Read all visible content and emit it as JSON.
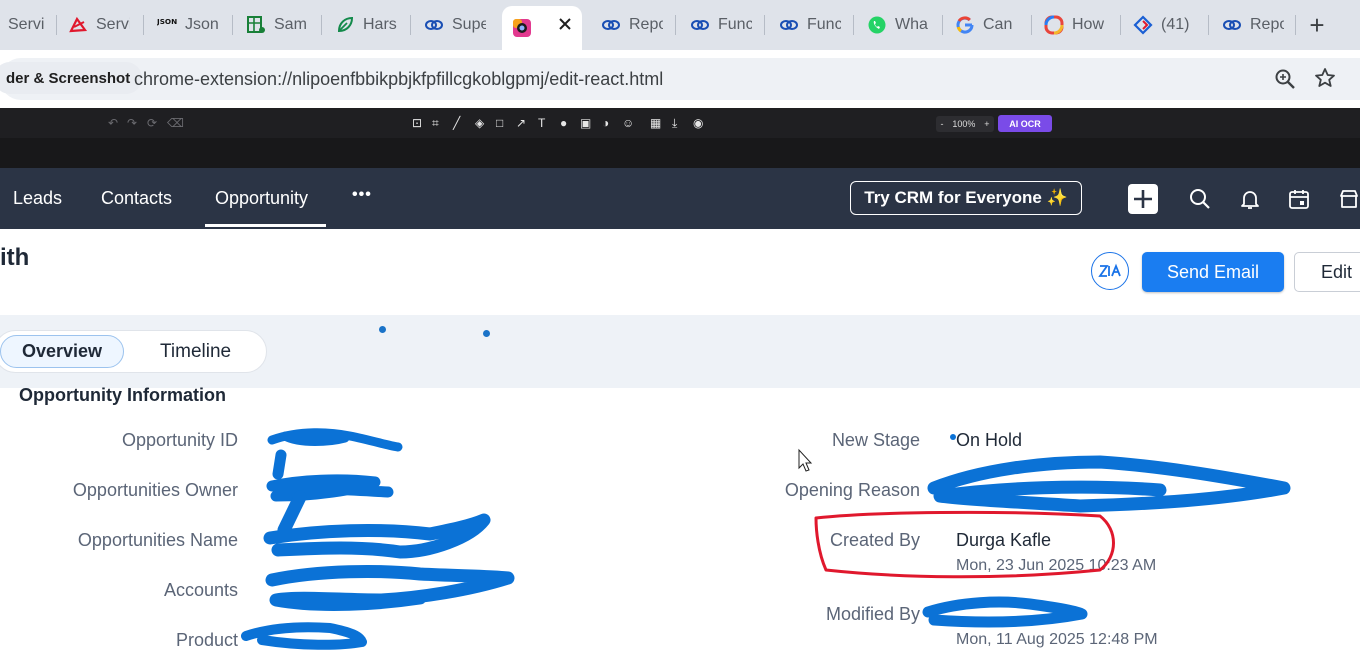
{
  "browser": {
    "tabs": [
      {
        "label": "Servi",
        "icon": "docs-icon"
      },
      {
        "label": "Servi",
        "icon": "zoho-icon"
      },
      {
        "label": "Json",
        "icon": "json-icon"
      },
      {
        "label": "Sam",
        "icon": "sheets-icon"
      },
      {
        "label": "Hars",
        "icon": "leaf-icon"
      },
      {
        "label": "Supe",
        "icon": "link-icon"
      },
      {
        "label": "",
        "icon": "screenshot-extension-icon"
      },
      {
        "label": "Repo",
        "icon": "link-icon"
      },
      {
        "label": "Func",
        "icon": "link-icon"
      },
      {
        "label": "Func",
        "icon": "link-icon"
      },
      {
        "label": "Wha",
        "icon": "whatsapp-icon"
      },
      {
        "label": "Can",
        "icon": "google-icon"
      },
      {
        "label": "How",
        "icon": "copilot-icon"
      },
      {
        "label": "(41)",
        "icon": "diamond-icon"
      },
      {
        "label": "Repo",
        "icon": "link-icon"
      }
    ],
    "new_tab": "+",
    "extension_chip": "der & Screenshot",
    "url": "chrome-extension://nlipoenfbbikpbjkfpfillcgkoblgpmj/edit-react.html"
  },
  "editor_toolbar": {
    "zoom_minus": "-",
    "zoom_value": "100%",
    "zoom_plus": "+",
    "ocr_label": "AI OCR"
  },
  "crm_nav": {
    "items": [
      "Leads",
      "Contacts",
      "Opportunity"
    ],
    "more": "•••",
    "try_crm": "Try CRM for Everyone ✨"
  },
  "record": {
    "title": "ith",
    "send_email": "Send Email",
    "edit": "Edit",
    "tabs": {
      "overview": "Overview",
      "timeline": "Timeline"
    }
  },
  "section": {
    "title": "Opportunity Information",
    "left_fields": [
      {
        "label": "Opportunity ID"
      },
      {
        "label": "Opportunities Owner"
      },
      {
        "label": "Opportunities Name"
      },
      {
        "label": "Accounts"
      },
      {
        "label": "Product"
      }
    ],
    "right_fields": {
      "new_stage": {
        "label": "New Stage",
        "value": "On Hold"
      },
      "opening_reason": {
        "label": "Opening Reason"
      },
      "created_by": {
        "label": "Created By",
        "value": "Durga Kafle",
        "timestamp": "Mon, 23 Jun 2025 10:23 AM"
      },
      "modified_by": {
        "label": "Modified By",
        "timestamp": "Mon, 11 Aug 2025 12:48 PM"
      }
    }
  },
  "colors": {
    "nav_bg": "#2b3445",
    "primary_button": "#1a7df1",
    "redaction": "#0b72d6",
    "annotation": "#e0182d"
  }
}
